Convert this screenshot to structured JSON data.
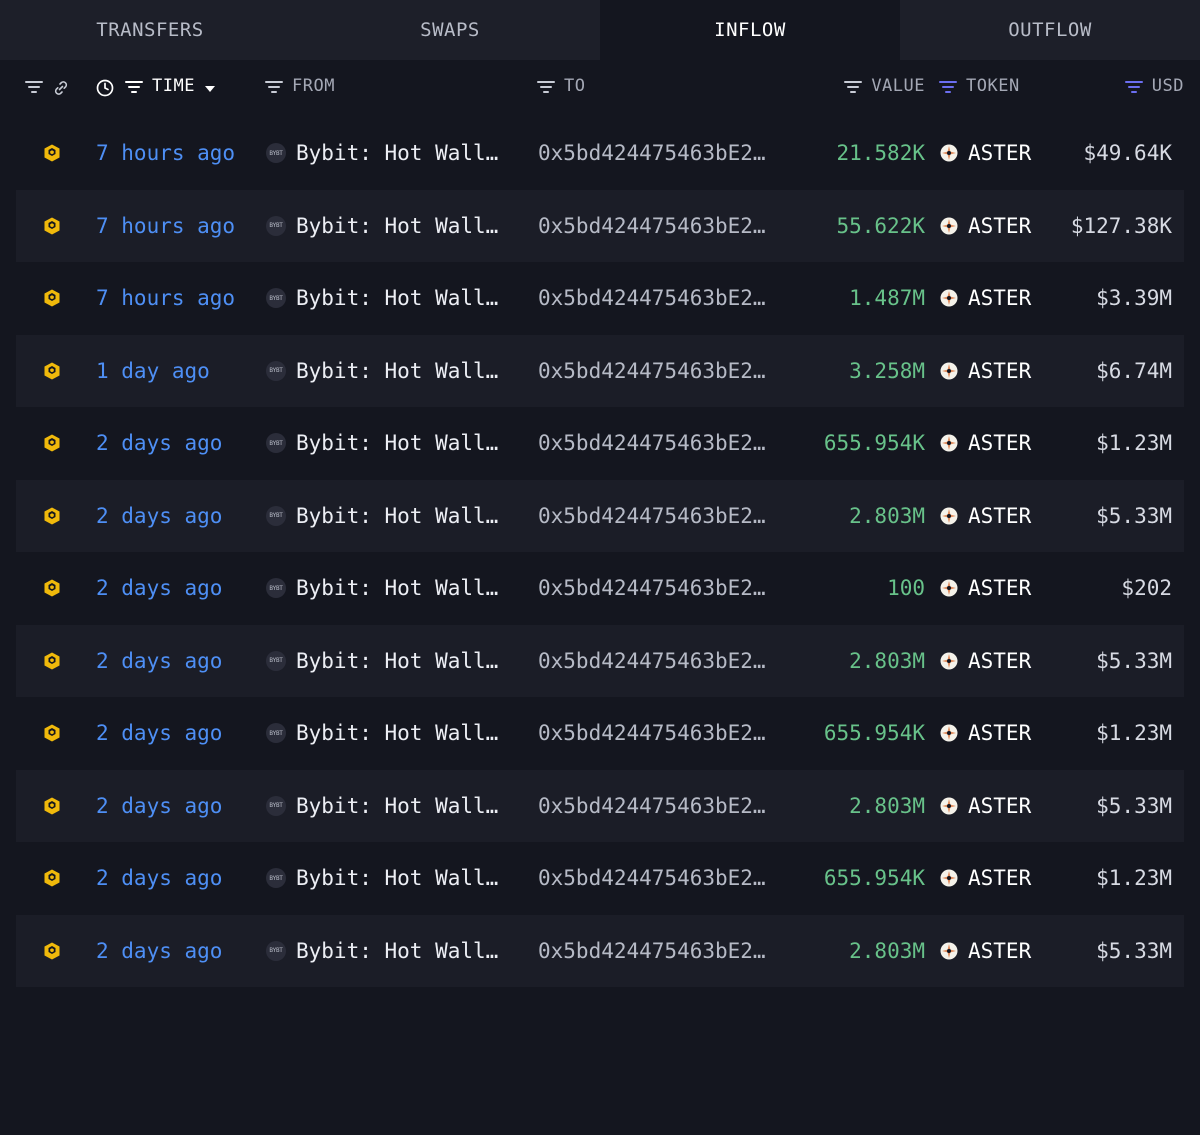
{
  "tabs": [
    {
      "label": "TRANSFERS",
      "active": false
    },
    {
      "label": "SWAPS",
      "active": false
    },
    {
      "label": "INFLOW",
      "active": true
    },
    {
      "label": "OUTFLOW",
      "active": false
    }
  ],
  "header": {
    "time": "TIME",
    "from": "FROM",
    "to": "TO",
    "value": "VALUE",
    "token": "TOKEN",
    "usd": "USD"
  },
  "colors": {
    "time_link": "#4e8ff5",
    "value_positive": "#68c28a",
    "token_filter": "#6b6ef0",
    "chain_icon": "#f0b90b"
  },
  "icons": {
    "chain": "bnb-chain-icon",
    "from_avatar": "bybit-avatar-icon",
    "token": "aster-token-icon"
  },
  "rows": [
    {
      "time": "7 hours ago",
      "from": "Bybit: Hot Wall…",
      "avatar": "BYBT",
      "to": "0x5bd424475463bE2…",
      "value": "21.582K",
      "token": "ASTER",
      "usd": "$49.64K"
    },
    {
      "time": "7 hours ago",
      "from": "Bybit: Hot Wall…",
      "avatar": "BYBT",
      "to": "0x5bd424475463bE2…",
      "value": "55.622K",
      "token": "ASTER",
      "usd": "$127.38K"
    },
    {
      "time": "7 hours ago",
      "from": "Bybit: Hot Wall…",
      "avatar": "BYBT",
      "to": "0x5bd424475463bE2…",
      "value": "1.487M",
      "token": "ASTER",
      "usd": "$3.39M"
    },
    {
      "time": "1 day ago",
      "from": "Bybit: Hot Wall…",
      "avatar": "BYBT",
      "to": "0x5bd424475463bE2…",
      "value": "3.258M",
      "token": "ASTER",
      "usd": "$6.74M"
    },
    {
      "time": "2 days ago",
      "from": "Bybit: Hot Wall…",
      "avatar": "BYBT",
      "to": "0x5bd424475463bE2…",
      "value": "655.954K",
      "token": "ASTER",
      "usd": "$1.23M"
    },
    {
      "time": "2 days ago",
      "from": "Bybit: Hot Wall…",
      "avatar": "BYBT",
      "to": "0x5bd424475463bE2…",
      "value": "2.803M",
      "token": "ASTER",
      "usd": "$5.33M"
    },
    {
      "time": "2 days ago",
      "from": "Bybit: Hot Wall…",
      "avatar": "BYBT",
      "to": "0x5bd424475463bE2…",
      "value": "100",
      "token": "ASTER",
      "usd": "$202"
    },
    {
      "time": "2 days ago",
      "from": "Bybit: Hot Wall…",
      "avatar": "BYBT",
      "to": "0x5bd424475463bE2…",
      "value": "2.803M",
      "token": "ASTER",
      "usd": "$5.33M"
    },
    {
      "time": "2 days ago",
      "from": "Bybit: Hot Wall…",
      "avatar": "BYBT",
      "to": "0x5bd424475463bE2…",
      "value": "655.954K",
      "token": "ASTER",
      "usd": "$1.23M"
    },
    {
      "time": "2 days ago",
      "from": "Bybit: Hot Wall…",
      "avatar": "BYBT",
      "to": "0x5bd424475463bE2…",
      "value": "2.803M",
      "token": "ASTER",
      "usd": "$5.33M"
    },
    {
      "time": "2 days ago",
      "from": "Bybit: Hot Wall…",
      "avatar": "BYBT",
      "to": "0x5bd424475463bE2…",
      "value": "655.954K",
      "token": "ASTER",
      "usd": "$1.23M"
    },
    {
      "time": "2 days ago",
      "from": "Bybit: Hot Wall…",
      "avatar": "BYBT",
      "to": "0x5bd424475463bE2…",
      "value": "2.803M",
      "token": "ASTER",
      "usd": "$5.33M"
    }
  ]
}
